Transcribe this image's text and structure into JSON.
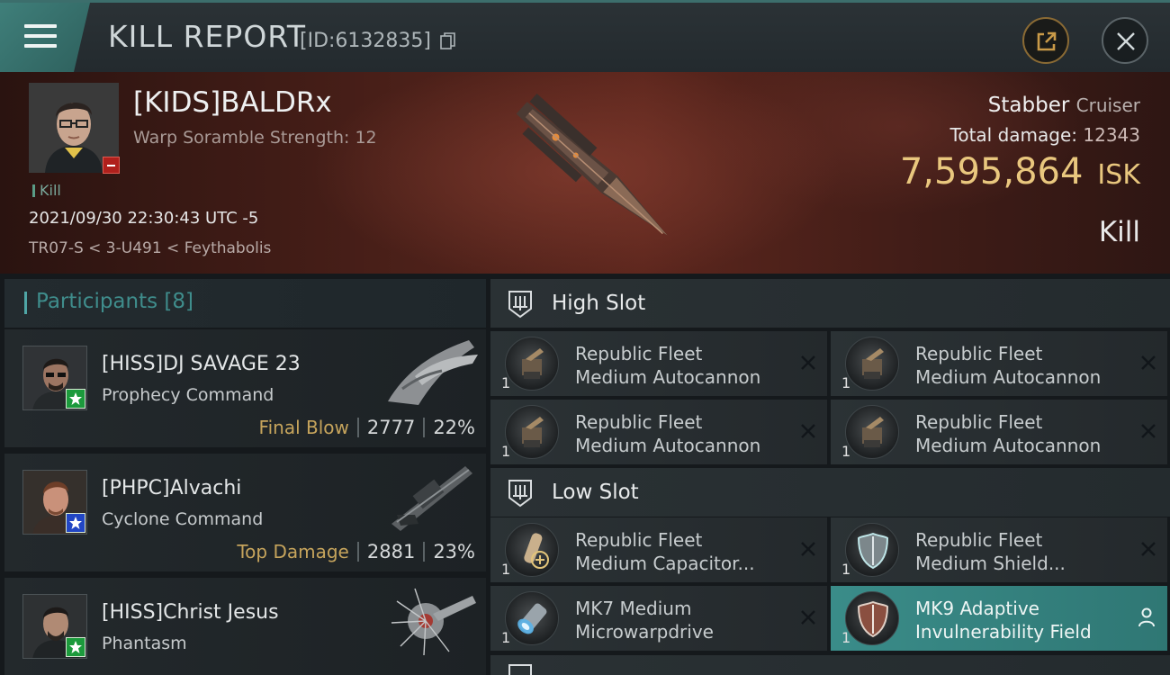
{
  "header": {
    "title": "KILL REPORT",
    "report_id": "[ID:6132835]"
  },
  "victim": {
    "name": "[KIDS]BALDRx",
    "subtitle": "Warp Soramble Strength: 12",
    "tag": "Kill",
    "time": "2021/09/30 22:30:43 UTC -5",
    "location": "TR07-S < 3-U491 < Feythabolis",
    "ship": "Stabber",
    "ship_class": "Cruiser",
    "total_damage_label": "Total damage:",
    "total_damage": "12343",
    "isk_value": "7,595,864",
    "isk_unit": "ISK",
    "result": "Kill"
  },
  "participants": {
    "title": "Participants",
    "count": "[8]",
    "items": [
      {
        "name": "[HISS]DJ SAVAGE 23",
        "ship": "Prophecy Command",
        "tag": "Final Blow",
        "damage": "2777",
        "percent": "22%",
        "badge": "green"
      },
      {
        "name": "[PHPC]Alvachi",
        "ship": "Cyclone Command",
        "tag": "Top Damage",
        "damage": "2881",
        "percent": "23%",
        "badge": "blue"
      },
      {
        "name": "[HISS]Christ Jesus",
        "ship": "Phantasm",
        "tag": "",
        "damage": "",
        "percent": "",
        "badge": "green"
      }
    ]
  },
  "slots": {
    "high": {
      "title": "High Slot",
      "modules": [
        {
          "line1": "Republic Fleet",
          "line2": "Medium Autocannon",
          "qty": "1"
        },
        {
          "line1": "Republic Fleet",
          "line2": "Medium Autocannon",
          "qty": "1"
        },
        {
          "line1": "Republic Fleet",
          "line2": "Medium Autocannon",
          "qty": "1"
        },
        {
          "line1": "Republic Fleet",
          "line2": "Medium Autocannon",
          "qty": "1"
        }
      ]
    },
    "low": {
      "title": "Low Slot",
      "modules": [
        {
          "line1": "Republic Fleet",
          "line2": "Medium Capacitor...",
          "qty": "1"
        },
        {
          "line1": "Republic Fleet",
          "line2": "Medium Shield...",
          "qty": "1"
        },
        {
          "line1": "MK7 Medium",
          "line2": "Microwarpdrive",
          "qty": "1"
        },
        {
          "line1": "MK9 Adaptive",
          "line2": "Invulnerability Field",
          "qty": "1"
        }
      ]
    }
  },
  "colors": {
    "accent": "#3f8d8c",
    "isk": "#e9c77e",
    "tag": "#c6a45c",
    "highlight": "#3a8c89"
  },
  "icons": [
    "menu-icon",
    "copy-icon",
    "share-icon",
    "close-icon",
    "star-icon",
    "slot-icon",
    "autocannon-icon",
    "capacitor-icon",
    "shield-icon",
    "microwarpdrive-icon",
    "invulnerability-icon",
    "remove-icon",
    "person-icon"
  ]
}
